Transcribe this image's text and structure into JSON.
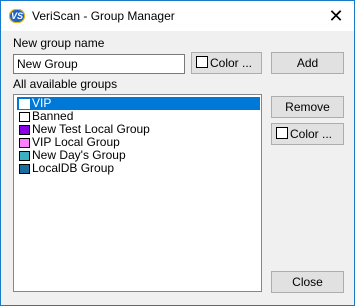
{
  "window": {
    "title": "VeriScan - Group Manager",
    "icon_text": "VS",
    "close_glyph": "✕"
  },
  "new_group": {
    "label": "New group name",
    "value": "New Group",
    "color_button_label": "Color ...",
    "swatch_color": "#ffffff",
    "add_label": "Add"
  },
  "groups": {
    "label": "All available groups",
    "items": [
      {
        "label": "VIP",
        "color": "#ffffff",
        "selected": true
      },
      {
        "label": "Banned",
        "color": "#ffffff",
        "selected": false
      },
      {
        "label": "New Test Local Group",
        "color": "#8a00e6",
        "selected": false
      },
      {
        "label": "VIP Local Group",
        "color": "#ff80ff",
        "selected": false
      },
      {
        "label": "New Day's Group",
        "color": "#3ab0c0",
        "selected": false
      },
      {
        "label": "LocalDB Group",
        "color": "#1a6e9e",
        "selected": false
      }
    ],
    "remove_label": "Remove",
    "color_button_label": "Color ...",
    "swatch_color": "#ffffff"
  },
  "footer": {
    "close_label": "Close"
  }
}
